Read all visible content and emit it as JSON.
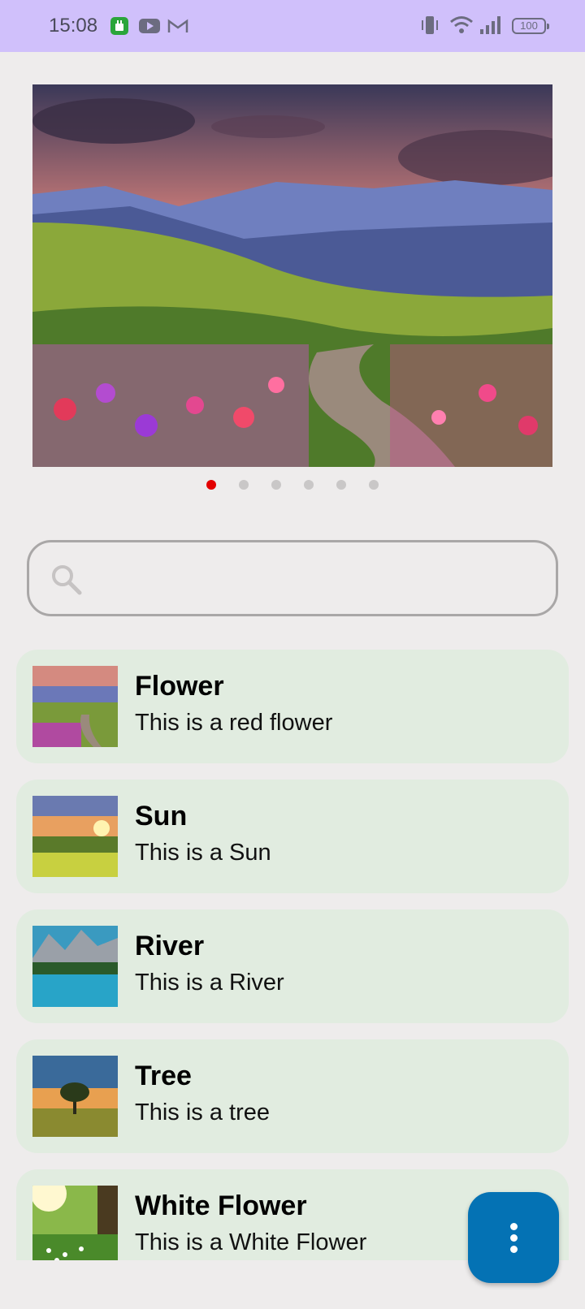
{
  "status_bar": {
    "time": "15:08",
    "battery": "100",
    "icons": [
      "android-app-icon",
      "youtube-icon",
      "gmail-icon",
      "vibrate-icon",
      "wifi-icon",
      "signal-icon",
      "battery-icon"
    ]
  },
  "carousel": {
    "page_count": 6,
    "active_index": 0,
    "active_color": "#e30000",
    "inactive_color": "#c9c7c7"
  },
  "search": {
    "placeholder": "",
    "value": ""
  },
  "items": [
    {
      "title": "Flower",
      "description": "This is a red flower",
      "image": "flower-landscape"
    },
    {
      "title": "Sun",
      "description": "This is a Sun",
      "image": "sunset-meadow"
    },
    {
      "title": "River",
      "description": "This is a River",
      "image": "mountain-lake"
    },
    {
      "title": "Tree",
      "description": "This is a tree",
      "image": "lone-tree"
    },
    {
      "title": "White Flower",
      "description": "This is a White Flower",
      "image": "white-flower-meadow"
    }
  ],
  "fab": {
    "icon": "more-vertical-icon",
    "color": "#0472b4"
  },
  "colors": {
    "status_bar": "#d0c0fb",
    "background": "#eeecec",
    "card": "#e1ece0"
  }
}
